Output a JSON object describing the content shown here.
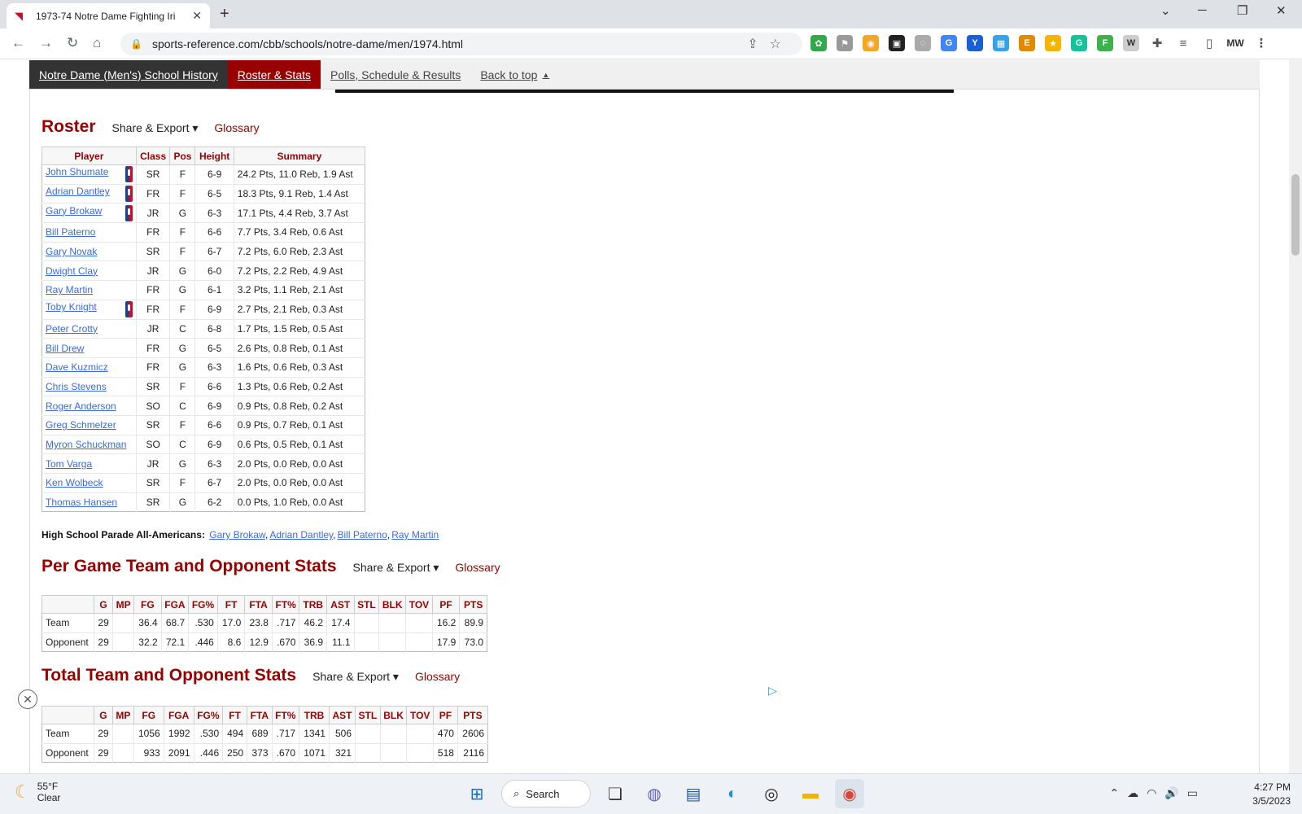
{
  "browser": {
    "tab_title": "1973-74 Notre Dame Fighting Iri",
    "url": "sports-reference.com/cbb/schools/notre-dame/men/1974.html",
    "profile_initials": "MW"
  },
  "sitenav": {
    "items": [
      "Notre Dame (Men's) School History",
      "Roster & Stats",
      "Polls, Schedule & Results",
      "Back to top"
    ],
    "back_arrow": "▲"
  },
  "roster": {
    "title": "Roster",
    "share": "Share & Export ▾",
    "glossary": "Glossary",
    "headers": [
      "Player",
      "Class",
      "Pos",
      "Height",
      "Summary"
    ],
    "rows": [
      {
        "player": "John Shumate",
        "nba": true,
        "class": "SR",
        "pos": "F",
        "height": "6-9",
        "summary": "24.2 Pts, 11.0 Reb, 1.9 Ast"
      },
      {
        "player": "Adrian Dantley",
        "nba": true,
        "class": "FR",
        "pos": "F",
        "height": "6-5",
        "summary": "18.3 Pts, 9.1 Reb, 1.4 Ast"
      },
      {
        "player": "Gary Brokaw",
        "nba": true,
        "class": "JR",
        "pos": "G",
        "height": "6-3",
        "summary": "17.1 Pts, 4.4 Reb, 3.7 Ast"
      },
      {
        "player": "Bill Paterno",
        "nba": false,
        "class": "FR",
        "pos": "F",
        "height": "6-6",
        "summary": "7.7 Pts, 3.4 Reb, 0.6 Ast"
      },
      {
        "player": "Gary Novak",
        "nba": false,
        "class": "SR",
        "pos": "F",
        "height": "6-7",
        "summary": "7.2 Pts, 6.0 Reb, 2.3 Ast"
      },
      {
        "player": "Dwight Clay",
        "nba": false,
        "class": "JR",
        "pos": "G",
        "height": "6-0",
        "summary": "7.2 Pts, 2.2 Reb, 4.9 Ast"
      },
      {
        "player": "Ray Martin",
        "nba": false,
        "class": "FR",
        "pos": "G",
        "height": "6-1",
        "summary": "3.2 Pts, 1.1 Reb, 2.1 Ast"
      },
      {
        "player": "Toby Knight",
        "nba": true,
        "class": "FR",
        "pos": "F",
        "height": "6-9",
        "summary": "2.7 Pts, 2.1 Reb, 0.3 Ast"
      },
      {
        "player": "Peter Crotty",
        "nba": false,
        "class": "JR",
        "pos": "C",
        "height": "6-8",
        "summary": "1.7 Pts, 1.5 Reb, 0.5 Ast"
      },
      {
        "player": "Bill Drew",
        "nba": false,
        "class": "FR",
        "pos": "G",
        "height": "6-5",
        "summary": "2.6 Pts, 0.8 Reb, 0.1 Ast"
      },
      {
        "player": "Dave Kuzmicz",
        "nba": false,
        "class": "FR",
        "pos": "G",
        "height": "6-3",
        "summary": "1.6 Pts, 0.6 Reb, 0.3 Ast"
      },
      {
        "player": "Chris Stevens",
        "nba": false,
        "class": "SR",
        "pos": "F",
        "height": "6-6",
        "summary": "1.3 Pts, 0.6 Reb, 0.2 Ast"
      },
      {
        "player": "Roger Anderson",
        "nba": false,
        "class": "SO",
        "pos": "C",
        "height": "6-9",
        "summary": "0.9 Pts, 0.8 Reb, 0.2 Ast"
      },
      {
        "player": "Greg Schmelzer",
        "nba": false,
        "class": "SR",
        "pos": "F",
        "height": "6-6",
        "summary": "0.9 Pts, 0.7 Reb, 0.1 Ast"
      },
      {
        "player": "Myron Schuckman",
        "nba": false,
        "class": "SO",
        "pos": "C",
        "height": "6-9",
        "summary": "0.6 Pts, 0.5 Reb, 0.1 Ast"
      },
      {
        "player": "Tom Varga",
        "nba": false,
        "class": "JR",
        "pos": "G",
        "height": "6-3",
        "summary": "2.0 Pts, 0.0 Reb, 0.0 Ast"
      },
      {
        "player": "Ken Wolbeck",
        "nba": false,
        "class": "SR",
        "pos": "F",
        "height": "6-7",
        "summary": "2.0 Pts, 0.0 Reb, 0.0 Ast"
      },
      {
        "player": "Thomas Hansen",
        "nba": false,
        "class": "SR",
        "pos": "G",
        "height": "6-2",
        "summary": "0.0 Pts, 1.0 Reb, 0.0 Ast"
      }
    ]
  },
  "parade": {
    "label": "High School Parade All-Americans:",
    "players": [
      "Gary Brokaw",
      "Adrian Dantley",
      "Bill Paterno",
      "Ray Martin"
    ]
  },
  "per_game": {
    "title": "Per Game Team and Opponent Stats",
    "share": "Share & Export ▾",
    "glossary": "Glossary",
    "headers": [
      "",
      "G",
      "MP",
      "FG",
      "FGA",
      "FG%",
      "FT",
      "FTA",
      "FT%",
      "TRB",
      "AST",
      "STL",
      "BLK",
      "TOV",
      "PF",
      "PTS"
    ],
    "rows": [
      [
        "Team",
        "29",
        "",
        "36.4",
        "68.7",
        ".530",
        "17.0",
        "23.8",
        ".717",
        "46.2",
        "17.4",
        "",
        "",
        "",
        "16.2",
        "89.9"
      ],
      [
        "Opponent",
        "29",
        "",
        "32.2",
        "72.1",
        ".446",
        "8.6",
        "12.9",
        ".670",
        "36.9",
        "11.1",
        "",
        "",
        "",
        "17.9",
        "73.0"
      ]
    ]
  },
  "totals": {
    "title": "Total Team and Opponent Stats",
    "share": "Share & Export ▾",
    "glossary": "Glossary",
    "headers": [
      "",
      "G",
      "MP",
      "FG",
      "FGA",
      "FG%",
      "FT",
      "FTA",
      "FT%",
      "TRB",
      "AST",
      "STL",
      "BLK",
      "TOV",
      "PF",
      "PTS"
    ],
    "rows": [
      [
        "Team",
        "29",
        "",
        "1056",
        "1992",
        ".530",
        "494",
        "689",
        ".717",
        "1341",
        "506",
        "",
        "",
        "",
        "470",
        "2606"
      ],
      [
        "Opponent",
        "29",
        "",
        "933",
        "2091",
        ".446",
        "250",
        "373",
        ".670",
        "1071",
        "321",
        "",
        "",
        "",
        "518",
        "2116"
      ]
    ]
  },
  "taskbar": {
    "temp": "55°F",
    "condition": "Clear",
    "search": "Search",
    "time": "4:27 PM",
    "date": "3/5/2023"
  }
}
